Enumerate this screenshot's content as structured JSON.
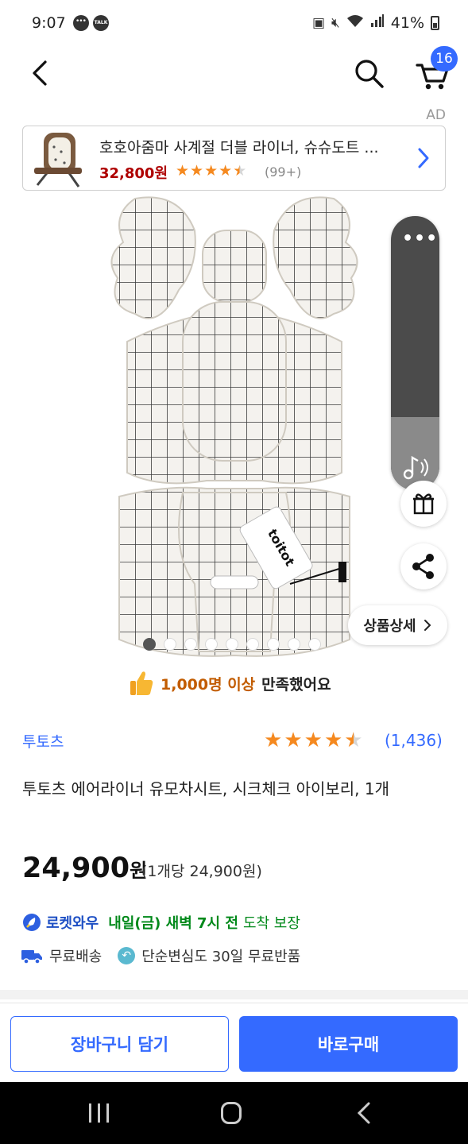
{
  "status_bar": {
    "time": "9:07",
    "talk_label": "TALK",
    "battery": "41%"
  },
  "header": {
    "cart_count": "16"
  },
  "ad": {
    "label": "AD",
    "title": "호호아줌마 사계절 더블 라이너, 슈슈도트 ...",
    "price": "32,800원",
    "rating": 4.5,
    "review_count": "(99+)"
  },
  "gallery": {
    "slide_count": 9,
    "active_index": 0,
    "tag_text": "toitot"
  },
  "floating": {
    "detail_label": "상품상세"
  },
  "satisfaction": {
    "count": "1,000명 이상",
    "rest": "만족했어요"
  },
  "product": {
    "brand": "투토츠",
    "rating": 4.5,
    "review_count": "(1,436)",
    "title": "투토츠 에어라이너 유모차시트, 시크체크 아이보리, 1개",
    "price": "24,900",
    "price_unit": "원",
    "unit_price": "(1개당 24,900원)"
  },
  "delivery": {
    "rocket_label": "로켓와우",
    "date": "내일(금) 새벽 7시 전",
    "guarantee": "도착 보장",
    "free_shipping": "무료배송",
    "return_policy": "단순변심도 30일 무료반품"
  },
  "actions": {
    "cart_label": "장바구니 담기",
    "buy_label": "바로구매"
  },
  "colors": {
    "accent": "#346aff",
    "price_red": "#ae0000",
    "delivery_green": "#00891a",
    "star": "#f5891f"
  }
}
